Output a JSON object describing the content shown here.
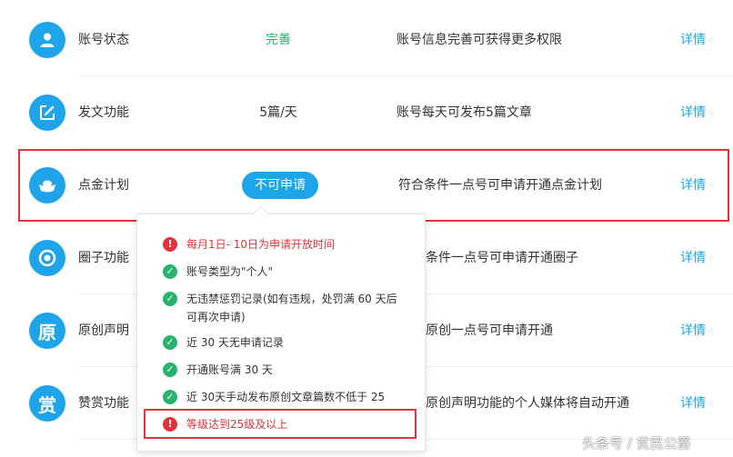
{
  "rows": [
    {
      "name": "账号状态",
      "status": "完善",
      "desc": "账号信息完善可获得更多权限",
      "link": "详情",
      "icon": "user-icon"
    },
    {
      "name": "发文功能",
      "status": "5篇/天",
      "desc": "账号每天可发布5篇文章",
      "link": "详情",
      "icon": "edit-icon"
    },
    {
      "name": "点金计划",
      "status": "不可申请",
      "desc": "符合条件一点号可申请开通点金计划",
      "link": "详情",
      "icon": "ingot-icon"
    },
    {
      "name": "圈子功能",
      "desc": "条件一点号可申请开通圈子",
      "link": "详情",
      "icon": "target-icon"
    },
    {
      "name": "原创声明",
      "icon_text": "原",
      "desc": "原创一点号可申请开通",
      "link": "详情",
      "icon": "original-icon"
    },
    {
      "name": "赞赏功能",
      "icon_text": "赏",
      "desc": "原创声明功能的个人媒体将自动开通",
      "link": "详情",
      "icon": "reward-icon"
    }
  ],
  "popup": {
    "conditions": [
      {
        "text": "每月1日- 10日为申请开放时间",
        "state": "warning"
      },
      {
        "text": "账号类型为\"个人\"",
        "state": "ok"
      },
      {
        "text": "无违禁惩罚记录(如有违规，处罚满 60 天后可再次申请)",
        "state": "ok"
      },
      {
        "text": "近 30 天无申请记录",
        "state": "ok"
      },
      {
        "text": "开通账号满 30 天",
        "state": "ok"
      },
      {
        "text": "近 30天手动发布原创文章篇数不低于 25",
        "state": "ok"
      },
      {
        "text": "等级达到25级及以上",
        "state": "warning"
      }
    ]
  },
  "watermark": "头条号 / 贫民公爵",
  "colors": {
    "accent": "#1ea4e8",
    "ok": "#27b36c",
    "warning": "#e0333a"
  }
}
